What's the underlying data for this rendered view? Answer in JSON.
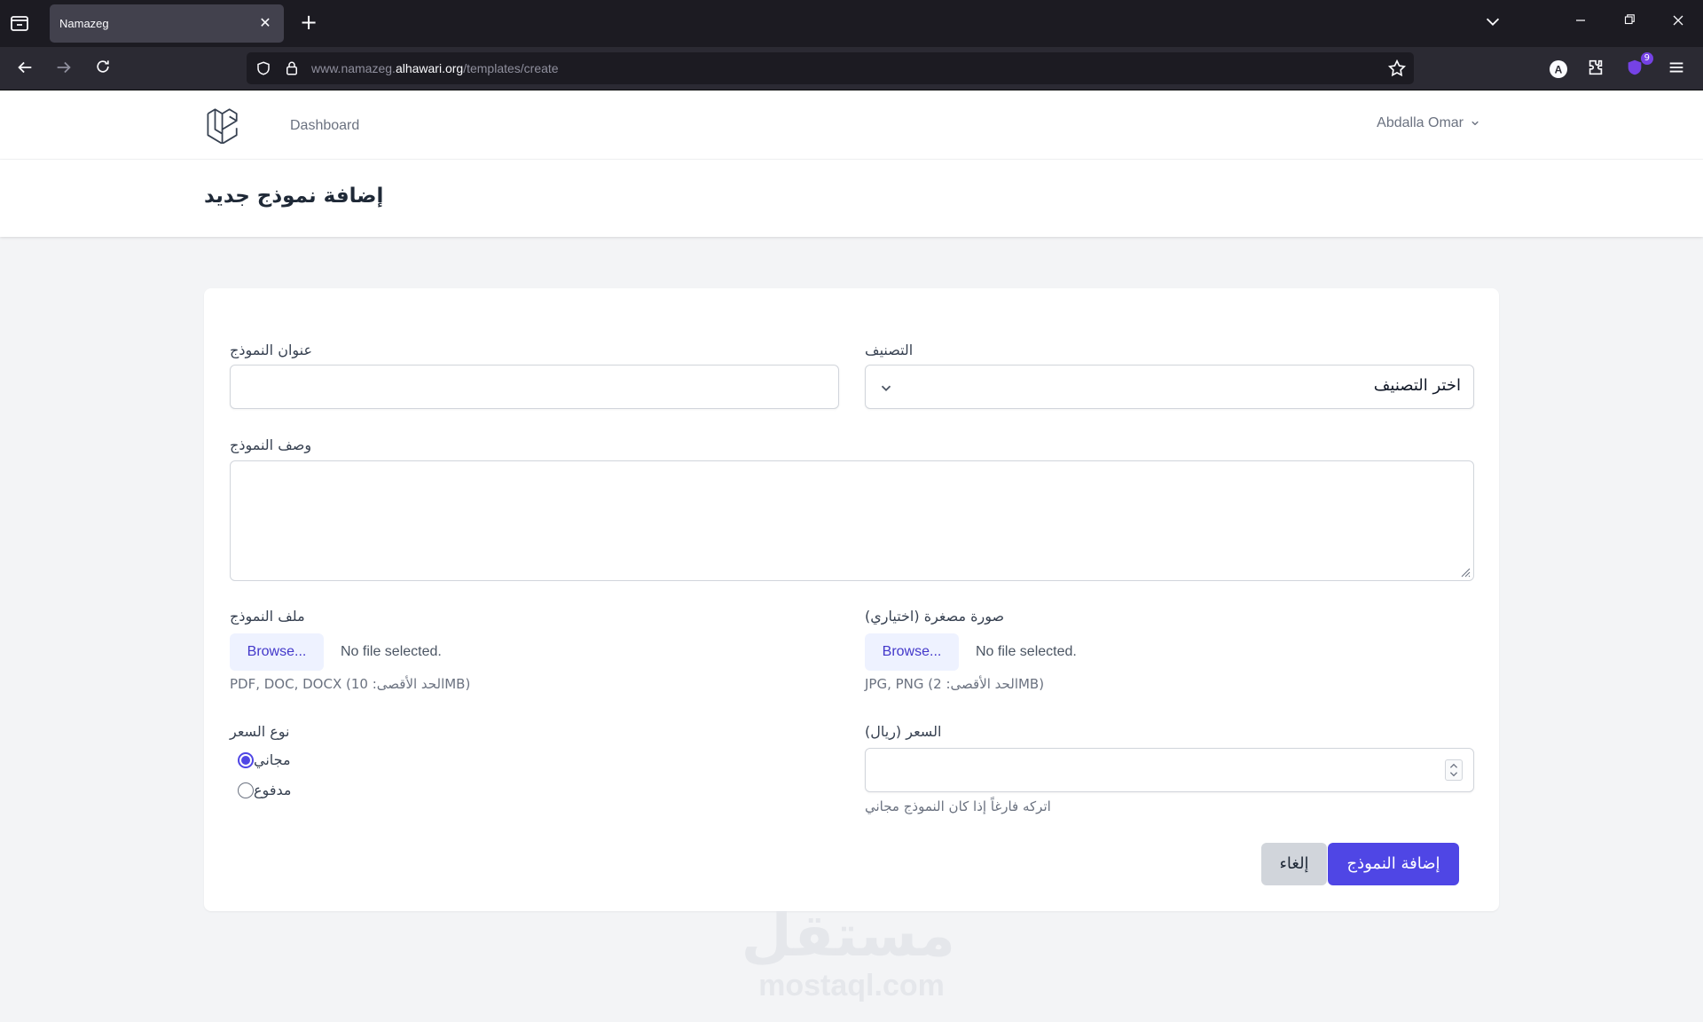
{
  "browser": {
    "tab_title": "Namazeg",
    "url_prefix": "www.namazeg.",
    "url_host": "alhawari.org",
    "url_path": "/templates/create",
    "extension_badge": "9",
    "account_icon_letter": "A"
  },
  "app": {
    "nav_link": "Dashboard",
    "user_name": "Abdalla Omar",
    "page_title": "إضافة نموذج جديد"
  },
  "form": {
    "title_label": "عنوان النموذج",
    "title_value": "",
    "category_label": "التصنيف",
    "category_selected": "اختر التصنيف",
    "description_label": "وصف النموذج",
    "description_value": "",
    "file_label": "ملف النموذج",
    "file_button": "Browse...",
    "file_status": "No file selected.",
    "file_hint": "PDF, DOC, DOCX (10 :الحد الأقصىMB)",
    "thumb_label": "صورة مصغرة (اختياري)",
    "thumb_button": "Browse...",
    "thumb_status": "No file selected.",
    "thumb_hint": "JPG, PNG (2 :الحد الأقصىMB)",
    "price_type_label": "نوع السعر",
    "price_options": [
      {
        "label": "مجاني",
        "checked": true
      },
      {
        "label": "مدفوع",
        "checked": false
      }
    ],
    "price_label": "السعر (ريال)",
    "price_value": "",
    "price_hint": "اتركه فارغاً إذا كان النموذج مجاني",
    "submit_label": "إضافة النموذج",
    "cancel_label": "إلغاء"
  },
  "watermark": {
    "arabic": "مستقل",
    "latin": "mostaql.com"
  },
  "colors": {
    "primary": "#4f46e5",
    "chrome_dark": "#1c1b22",
    "chrome_toolbar": "#2b2a33",
    "page_bg": "#f3f4f6"
  },
  "icons": {
    "tab_list": "tab-list-icon",
    "close": "close-icon",
    "new_tab": "plus-icon",
    "back": "arrow-left-icon",
    "forward": "arrow-right-icon",
    "reload": "reload-icon",
    "shield": "shield-icon",
    "lock": "lock-icon",
    "star": "star-icon",
    "extensions": "puzzle-icon",
    "menu": "hamburger-icon",
    "logo": "laravel-logo-icon",
    "chevron": "chevron-down-icon"
  }
}
